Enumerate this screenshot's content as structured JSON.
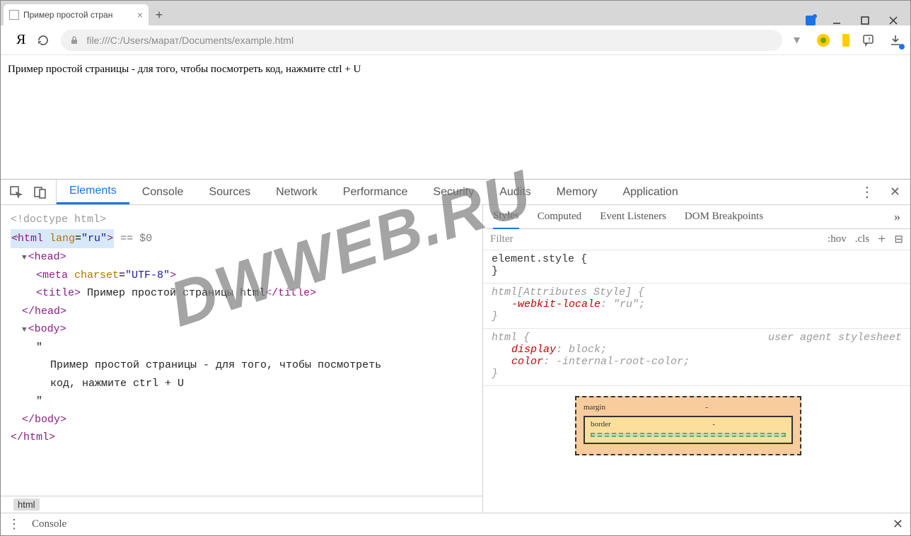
{
  "window": {
    "tab_title": "Пример простой стран",
    "address": "file:///C:/Users/марат/Documents/example.html"
  },
  "page": {
    "body_text": "Пример простой страницы - для того, чтобы посмотреть код, нажмите ctrl + U"
  },
  "devtools": {
    "tabs": [
      "Elements",
      "Console",
      "Sources",
      "Network",
      "Performance",
      "Security",
      "Audits",
      "Memory",
      "Application"
    ],
    "active_tab": "Elements",
    "dom": {
      "doctype": "<!doctype html>",
      "html_open": "<html lang=\"ru\">",
      "selection_suffix": " == $0",
      "head_open": "<head>",
      "meta": "<meta charset=\"UTF-8\">",
      "title_open": "<title>",
      "title_text": " Пример простой страницы html",
      "title_close": "</title>",
      "head_close": "</head>",
      "body_open": "<body>",
      "quote": "\"",
      "body_text": "Пример простой страницы - для того, чтобы посмотреть код, нажмите ctrl + U",
      "body_close": "</body>",
      "html_close": "</html>"
    },
    "breadcrumb": "html",
    "styles": {
      "tabs": [
        "Styles",
        "Computed",
        "Event Listeners",
        "DOM Breakpoints"
      ],
      "filter_placeholder": "Filter",
      "hov": ":hov",
      "cls": ".cls",
      "rule1": {
        "selector": "element.style {",
        "close": "}"
      },
      "rule2": {
        "selector": "html[Attributes Style] {",
        "prop1": "-webkit-locale",
        "val1": "\"ru\"",
        "close": "}"
      },
      "rule3": {
        "selector": "html {",
        "ua": "user agent stylesheet",
        "prop1": "display",
        "val1": "block",
        "prop2": "color",
        "val2": "-internal-root-color",
        "close": "}"
      },
      "boxmodel": {
        "margin": "margin",
        "margin_val": "-",
        "border": "border",
        "border_val": "-"
      }
    },
    "console_drawer": "Console"
  },
  "watermark": "DWWEB.RU"
}
